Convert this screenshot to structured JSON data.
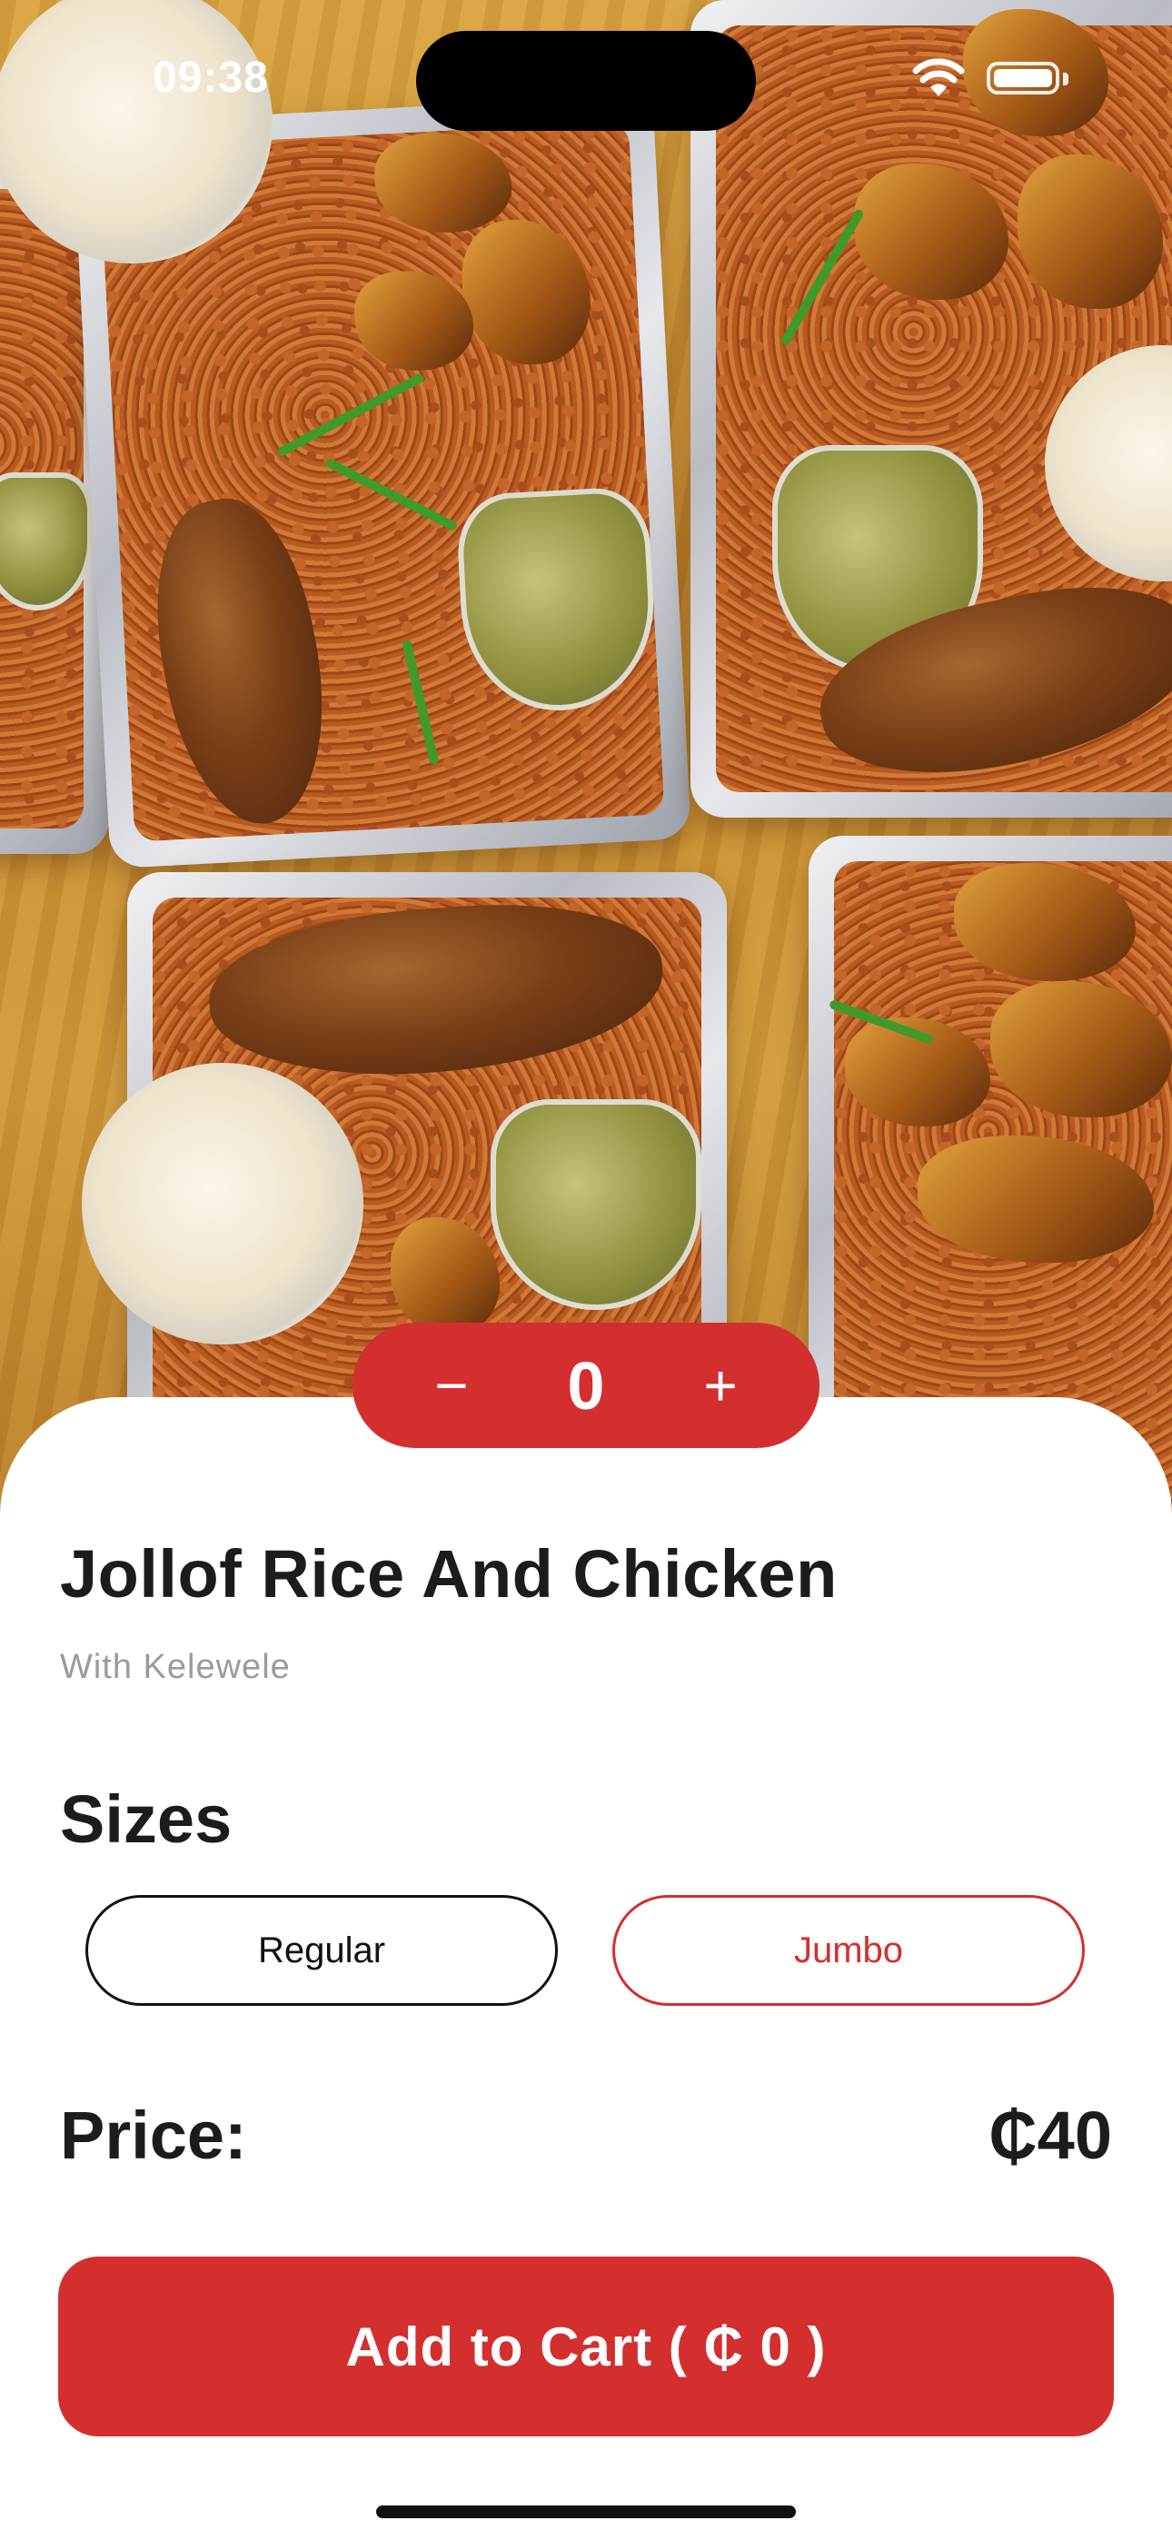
{
  "status_bar": {
    "time": "09:38"
  },
  "hero": {
    "image_alt": "Jollof rice with chicken, plantain, coleslaw and pepper sauce in foil trays",
    "icons": [
      "wifi-icon",
      "battery-icon"
    ]
  },
  "stepper": {
    "minus_label": "−",
    "quantity": "0",
    "plus_label": "+"
  },
  "product": {
    "title": "Jollof Rice And Chicken",
    "subtitle": "With Kelewele"
  },
  "sizes": {
    "heading": "Sizes",
    "options": [
      {
        "label": "Regular",
        "selected": false
      },
      {
        "label": "Jumbo",
        "selected": true
      }
    ]
  },
  "price": {
    "label": "Price:",
    "value": "₵40"
  },
  "cart": {
    "button_label": "Add to Cart ( ₵ 0 )"
  },
  "colors": {
    "accent": "#d32f2f",
    "text": "#1c1c1e",
    "muted": "#9a9a9f"
  }
}
